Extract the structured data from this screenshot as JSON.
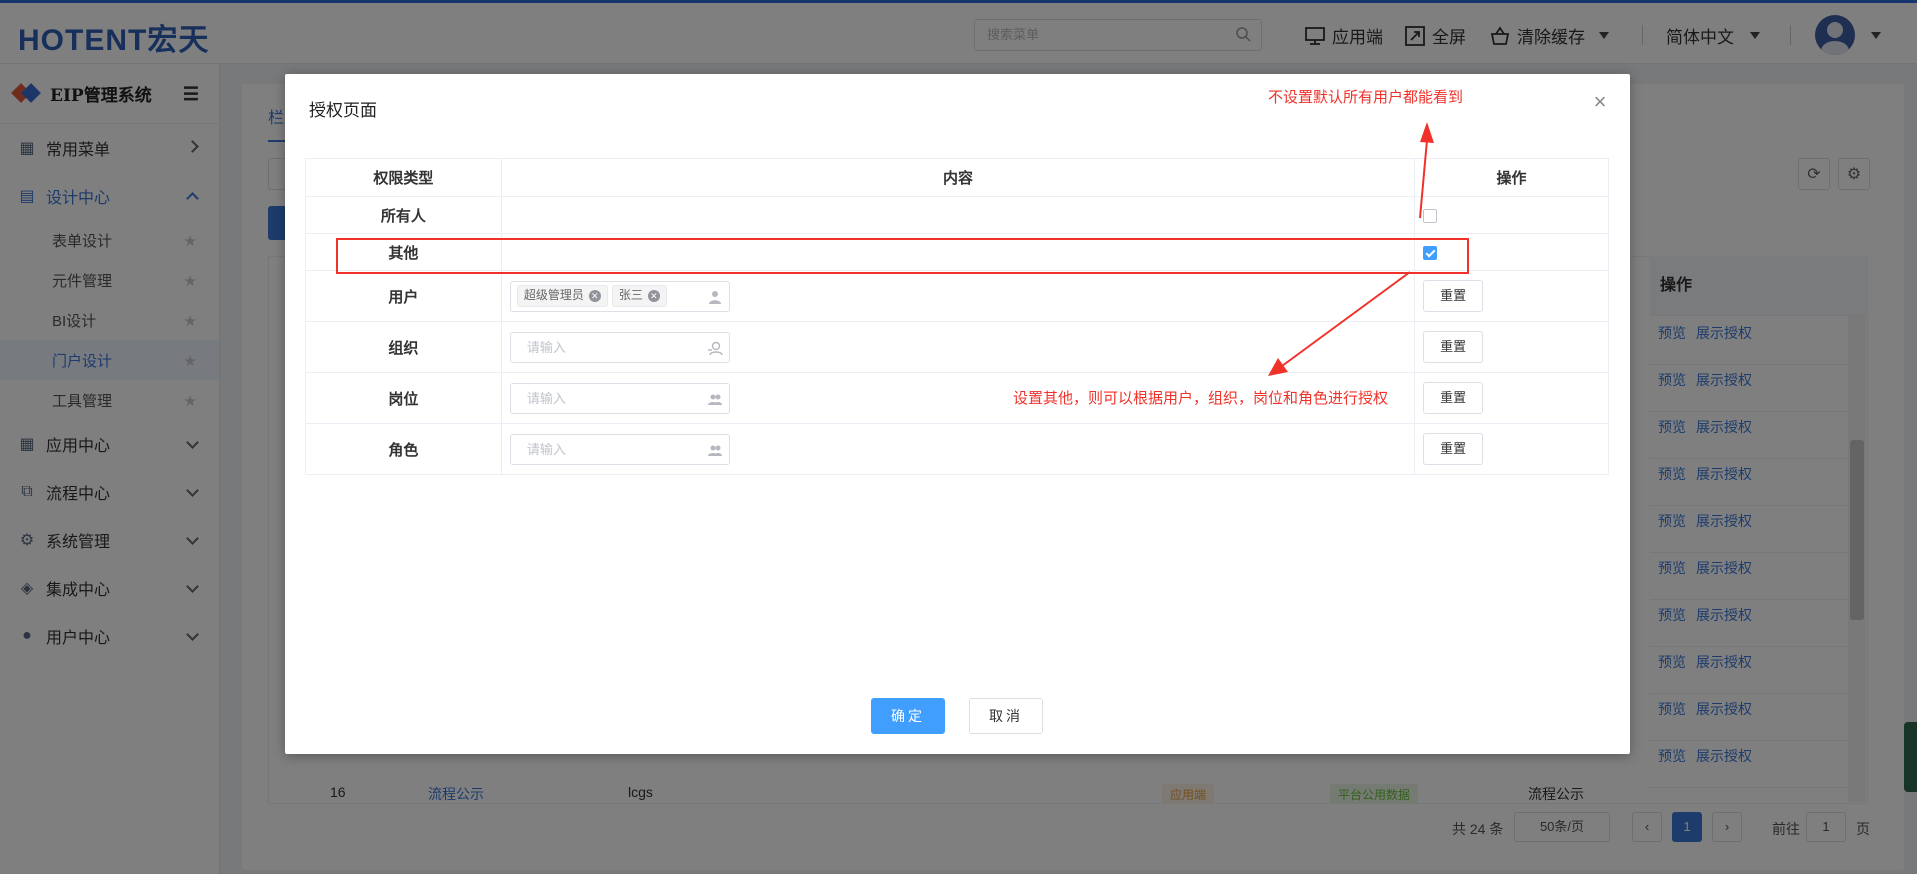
{
  "header": {
    "logo": "HOTENT宏天",
    "search_placeholder": "搜索菜单",
    "app_end": "应用端",
    "fullscreen": "全屏",
    "clear_cache": "清除缓存",
    "language": "简体中文"
  },
  "sidebar": {
    "title": "EIP管理系统",
    "items": [
      {
        "label": "常用菜单"
      },
      {
        "label": "设计中心"
      },
      {
        "label": "应用中心"
      },
      {
        "label": "流程中心"
      },
      {
        "label": "系统管理"
      },
      {
        "label": "集成中心"
      },
      {
        "label": "用户中心"
      }
    ],
    "sub_items": [
      {
        "label": "表单设计"
      },
      {
        "label": "元件管理"
      },
      {
        "label": "BI设计"
      },
      {
        "label": "门户设计"
      },
      {
        "label": "工具管理"
      }
    ]
  },
  "background": {
    "tab_fragment": "栏",
    "op_header": "操作",
    "row_links": [
      "预览",
      "展示授权"
    ],
    "last_row": {
      "no": "16",
      "name": "流程公示",
      "key": "lcgs",
      "tag1": "应用端",
      "tag2": "平台公用数据",
      "desc": "流程公示"
    },
    "pager": {
      "total": "共 24 条",
      "page_size": "50条/页",
      "current": "1",
      "goto_label": "前往",
      "goto_value": "1",
      "page_suffix": "页"
    }
  },
  "dialog": {
    "title": "授权页面",
    "columns": [
      "权限类型",
      "内容",
      "操作"
    ],
    "rows": [
      {
        "type": "所有人"
      },
      {
        "type": "其他"
      },
      {
        "type": "用户",
        "tags": [
          "超级管理员",
          "张三"
        ]
      },
      {
        "type": "组织",
        "placeholder": "请输入"
      },
      {
        "type": "岗位",
        "placeholder": "请输入"
      },
      {
        "type": "角色",
        "placeholder": "请输入"
      }
    ],
    "reset_label": "重置",
    "checkboxes": {
      "all": false,
      "other": true
    },
    "ok": "确定",
    "cancel": "取消"
  },
  "annotations": {
    "top_note": "不设置默认所有用户都能看到",
    "mid_note": "设置其他，则可以根据用户，组织，岗位和角色进行授权"
  },
  "colors": {
    "accent": "#409eff",
    "annotation": "#f0322b",
    "brand": "#2e5fb7"
  }
}
